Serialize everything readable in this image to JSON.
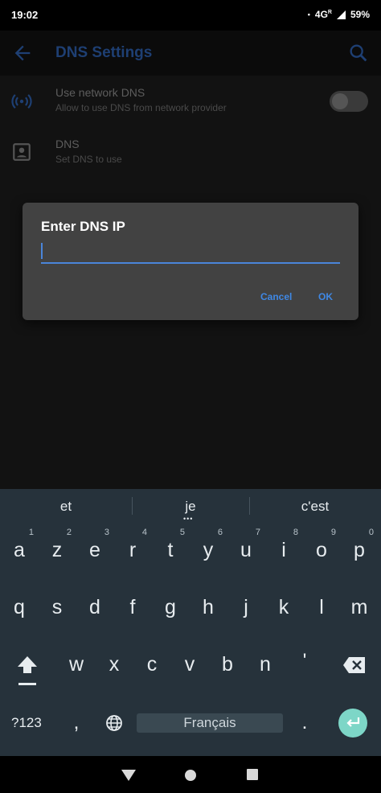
{
  "status_bar": {
    "time": "19:02",
    "dot": "•",
    "network": "4G",
    "network_sup": "R",
    "battery": "59%"
  },
  "app_bar": {
    "title": "DNS Settings",
    "back_icon": "arrow-back-icon",
    "search_icon": "search-icon",
    "title_color": "#1e3f73"
  },
  "settings": [
    {
      "title": "Use network DNS",
      "subtitle": "Allow to use DNS from network provider",
      "icon": "wifi-signal-icon",
      "toggle": false
    },
    {
      "title": "DNS",
      "subtitle": "Set DNS to use",
      "icon": "contact-card-icon"
    }
  ],
  "dialog": {
    "title": "Enter DNS IP",
    "input_value": "",
    "cancel_label": "Cancel",
    "ok_label": "OK",
    "accent": "#3f88e5"
  },
  "keyboard": {
    "suggestions": [
      "et",
      "je",
      "c'est"
    ],
    "row1": [
      {
        "key": "a",
        "hint": "1"
      },
      {
        "key": "z",
        "hint": "2"
      },
      {
        "key": "e",
        "hint": "3"
      },
      {
        "key": "r",
        "hint": "4"
      },
      {
        "key": "t",
        "hint": "5"
      },
      {
        "key": "y",
        "hint": "6"
      },
      {
        "key": "u",
        "hint": "7"
      },
      {
        "key": "i",
        "hint": "8"
      },
      {
        "key": "o",
        "hint": "9"
      },
      {
        "key": "p",
        "hint": "0"
      }
    ],
    "row2": [
      "q",
      "s",
      "d",
      "f",
      "g",
      "h",
      "j",
      "k",
      "l",
      "m"
    ],
    "row3": [
      "w",
      "x",
      "c",
      "v",
      "b",
      "n",
      "'"
    ],
    "symbols_label": "?123",
    "comma": ",",
    "space_label": "Français",
    "period": ".",
    "shift_icon": "shift-icon",
    "backspace_icon": "backspace-icon",
    "globe_icon": "globe-icon",
    "enter_icon": "enter-icon",
    "enter_color": "#7dd6c7"
  },
  "nav_bar": {
    "back_icon": "nav-back-icon",
    "home_icon": "nav-home-icon",
    "recents_icon": "nav-recents-icon"
  }
}
